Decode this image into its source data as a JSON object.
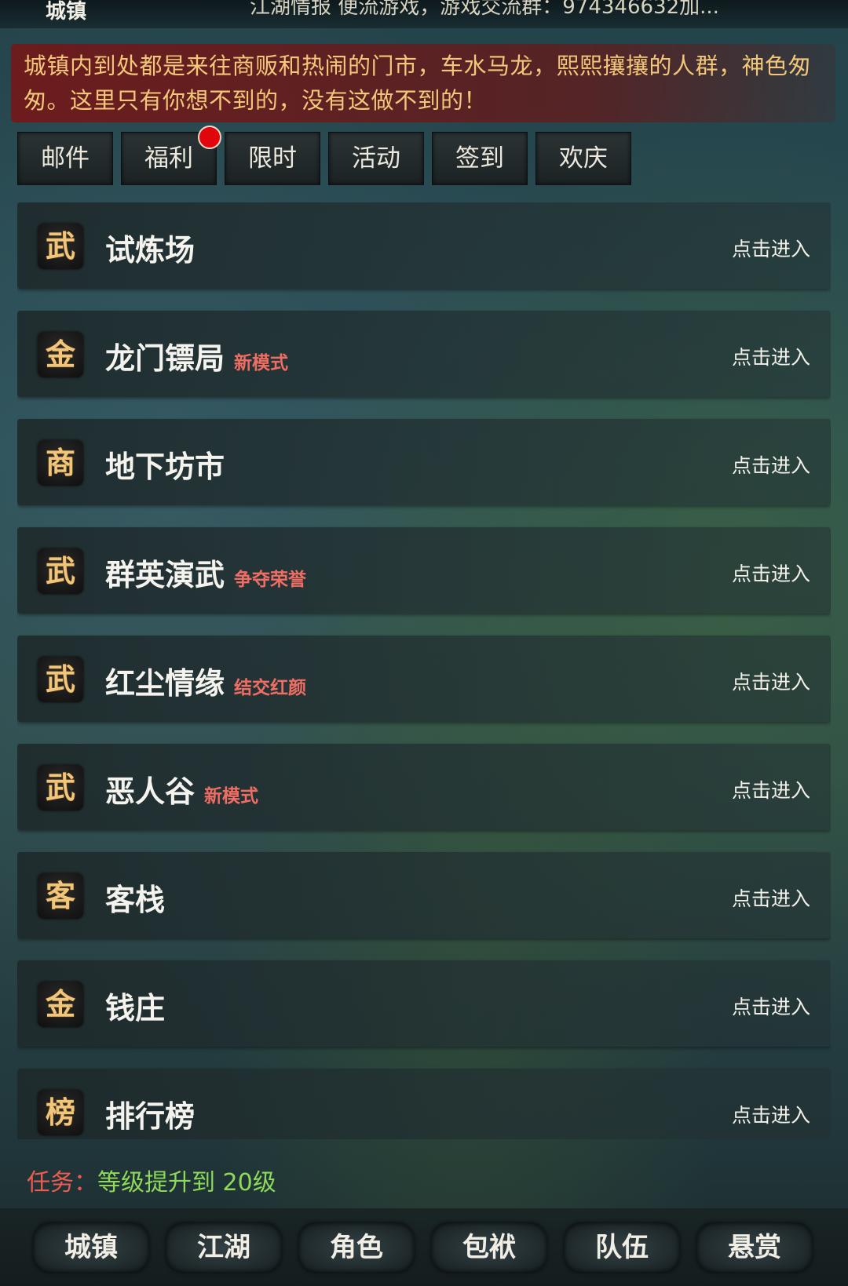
{
  "header": {
    "location": "城镇",
    "marquee": "江湖情报 便流游戏，游戏交流群：974346632加..."
  },
  "intro": {
    "text": "城镇内到处都是来往商贩和热闹的门市，车水马龙，熙熙攘攘的人群，神色匆匆。这里只有你想不到的，没有这做不到的！"
  },
  "tabs": [
    {
      "label": "邮件",
      "has_badge": false
    },
    {
      "label": "福利",
      "has_badge": true
    },
    {
      "label": "限时",
      "has_badge": false
    },
    {
      "label": "活动",
      "has_badge": false
    },
    {
      "label": "签到",
      "has_badge": false
    },
    {
      "label": "欢庆",
      "has_badge": false
    }
  ],
  "locations": [
    {
      "icon_char": "武",
      "name": "试炼场",
      "tag": "",
      "action": "点击进入"
    },
    {
      "icon_char": "金",
      "name": "龙门镖局",
      "tag": "新模式",
      "action": "点击进入"
    },
    {
      "icon_char": "商",
      "name": "地下坊市",
      "tag": "",
      "action": "点击进入"
    },
    {
      "icon_char": "武",
      "name": "群英演武",
      "tag": "争夺荣誉",
      "action": "点击进入"
    },
    {
      "icon_char": "武",
      "name": "红尘情缘",
      "tag": "结交红颜",
      "action": "点击进入"
    },
    {
      "icon_char": "武",
      "name": "恶人谷",
      "tag": "新模式",
      "action": "点击进入"
    },
    {
      "icon_char": "客",
      "name": "客栈",
      "tag": "",
      "action": "点击进入"
    },
    {
      "icon_char": "金",
      "name": "钱庄",
      "tag": "",
      "action": "点击进入"
    },
    {
      "icon_char": "榜",
      "name": "排行榜",
      "tag": "",
      "action": "点击进入"
    }
  ],
  "task": {
    "label": "任务：",
    "text": "等级提升到 20级"
  },
  "bottom_nav": [
    {
      "label": "城镇"
    },
    {
      "label": "江湖"
    },
    {
      "label": "角色"
    },
    {
      "label": "包袱"
    },
    {
      "label": "队伍"
    },
    {
      "label": "悬赏"
    }
  ],
  "colors": {
    "intro_text": "#f3c77a",
    "intro_bg": "#7a1a1a",
    "tag_text": "#f06d63",
    "task_label": "#ee5b51",
    "task_text": "#8fd95a",
    "icon_char": "#f1c67b",
    "badge": "#e0060b"
  }
}
